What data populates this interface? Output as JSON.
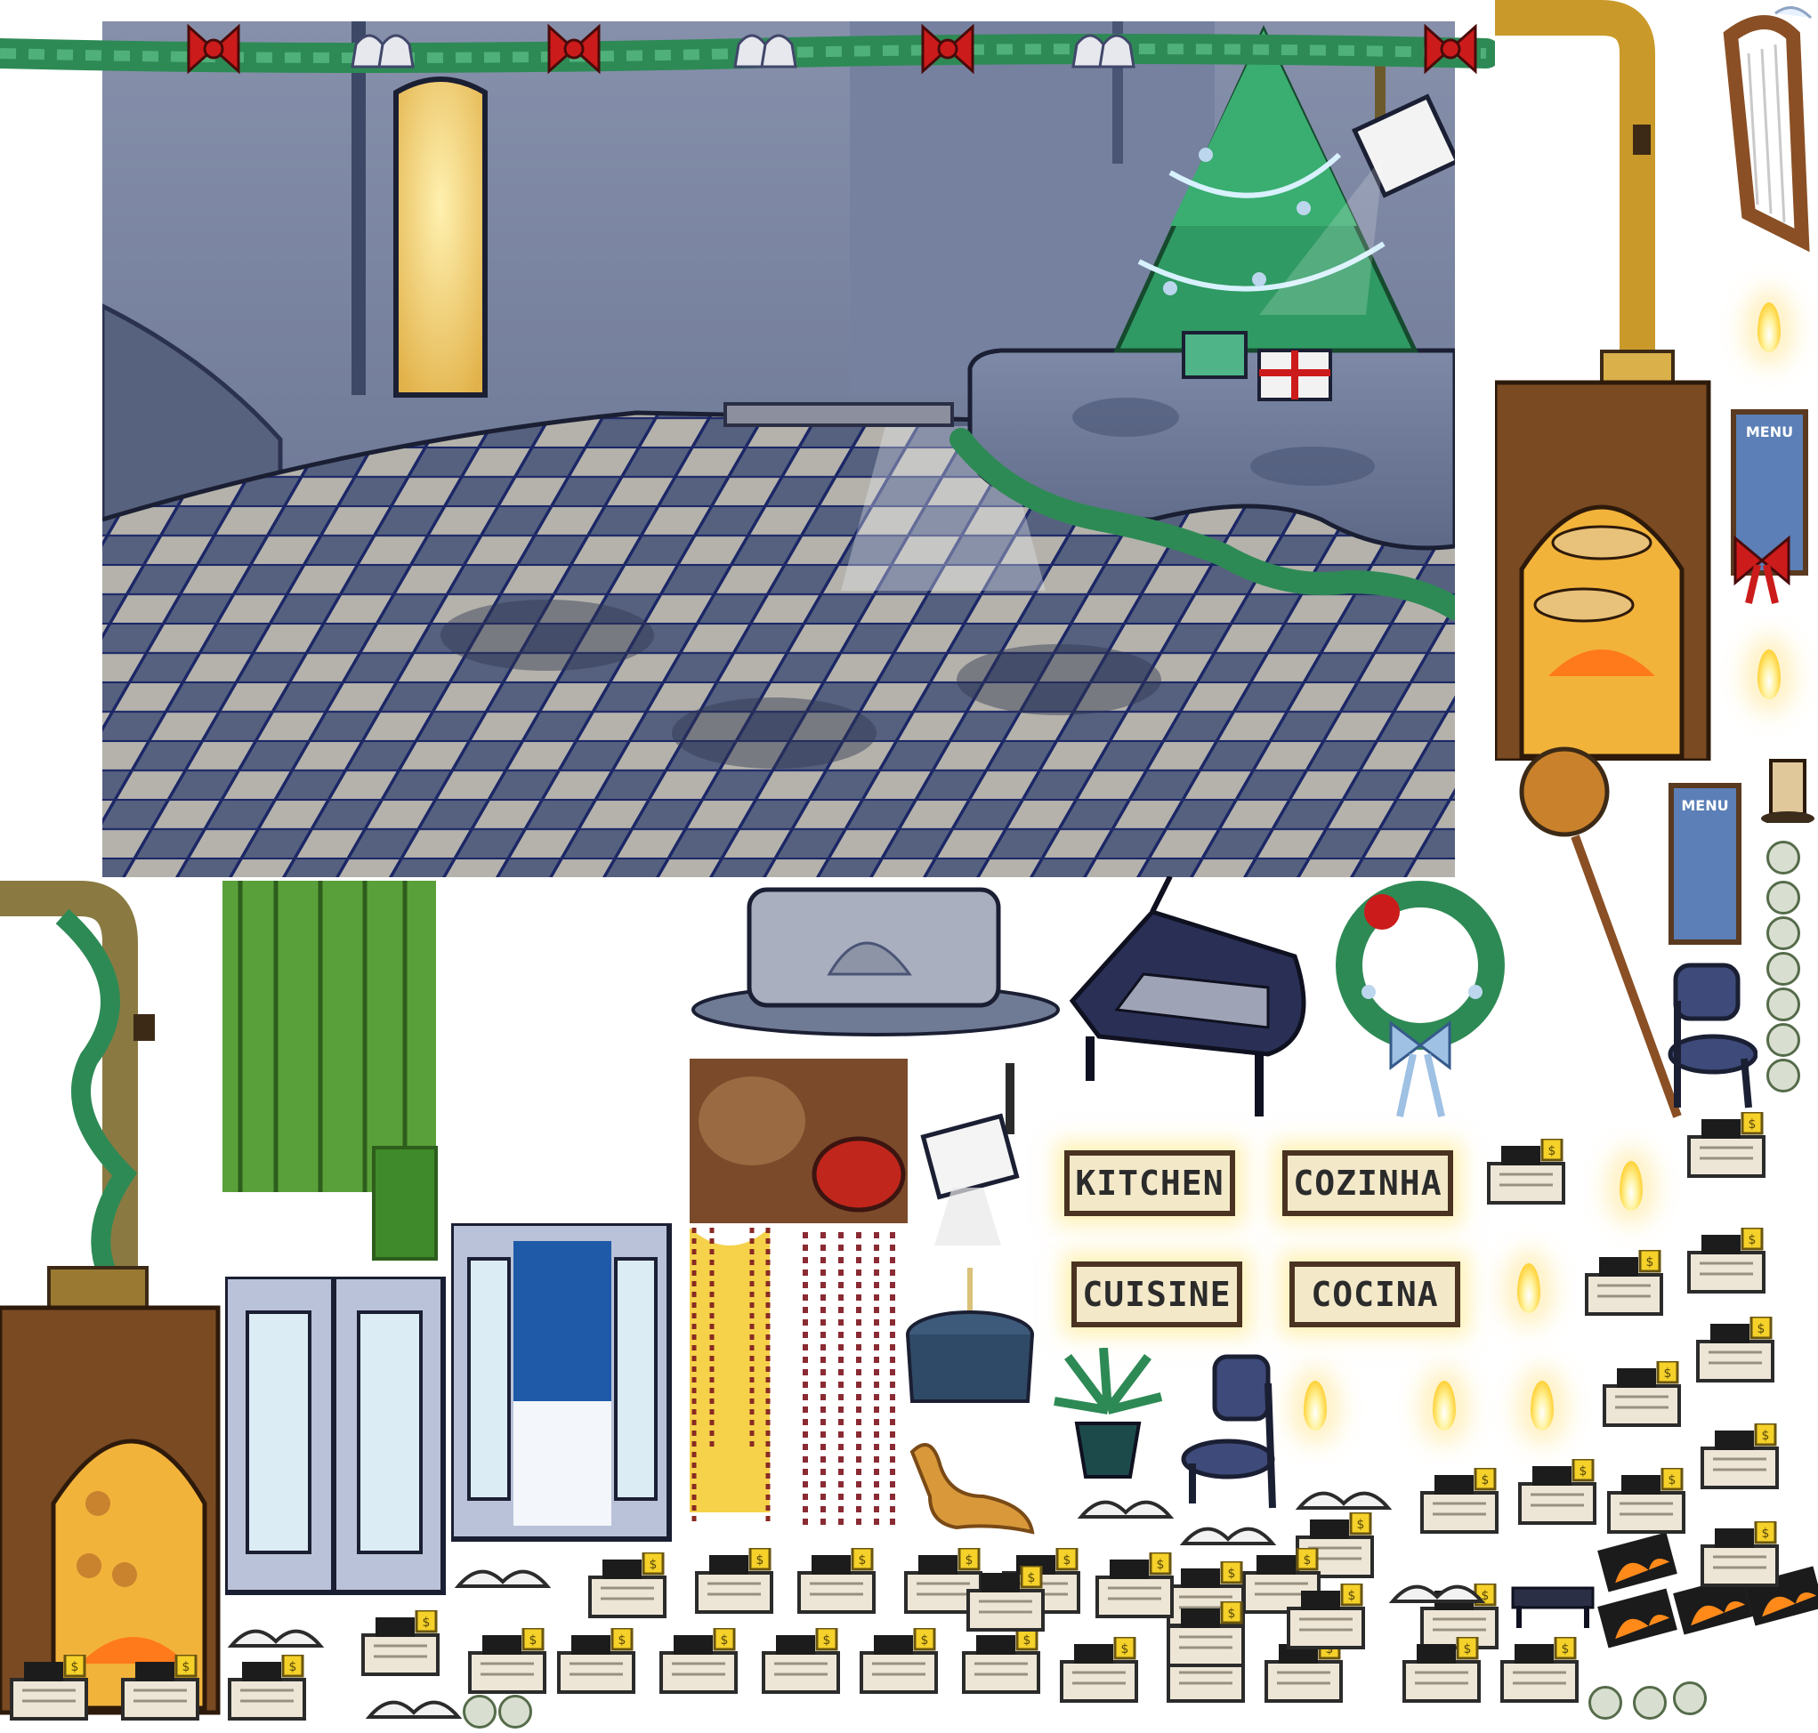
{
  "scene": {
    "type": "pizza-parlor-holiday-room",
    "colors": {
      "wall": "#6f7c99",
      "floor_light": "#b8b5ad",
      "floor_dark": "#5a6582",
      "tile_lines": "#1f2a6b",
      "garland": "#2e8a55",
      "bow": "#cc1b1b",
      "doorway_light": "#f6d77a"
    }
  },
  "signs": {
    "kitchen": "KITCHEN",
    "cozinha": "COZINHA",
    "cuisine": "CUISINE",
    "cocina": "COCINA"
  },
  "menu_boards": {
    "top": "MENU",
    "middle": "MENU"
  },
  "icons": {
    "register_tag": "$"
  }
}
